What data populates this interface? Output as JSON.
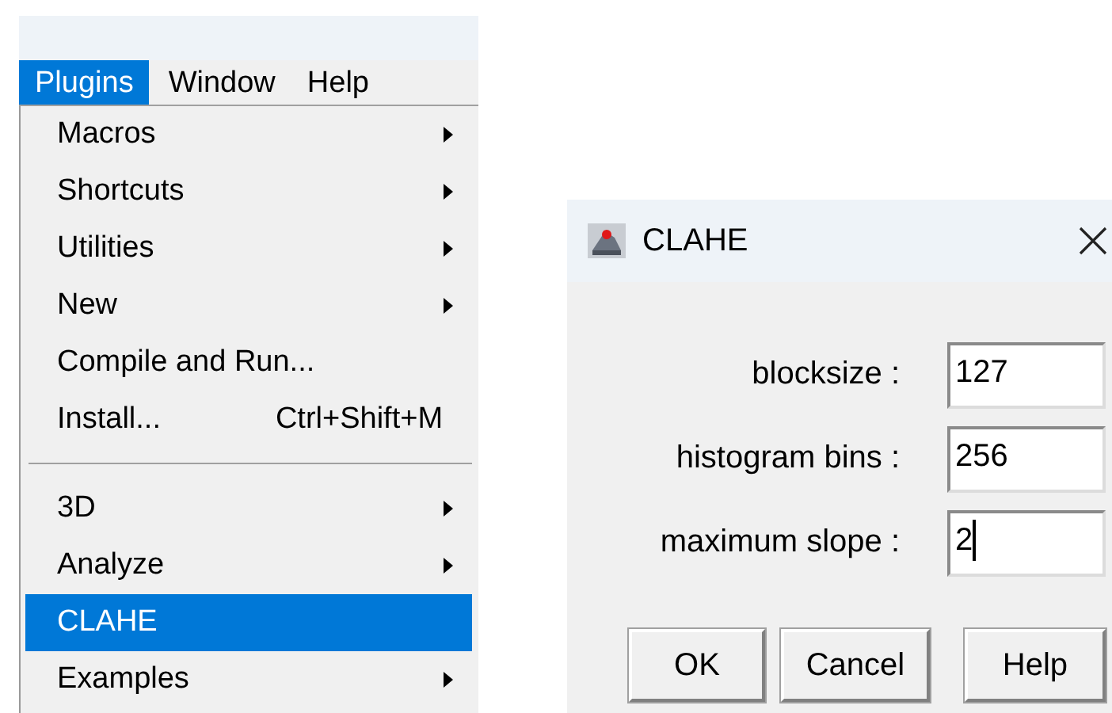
{
  "menubar": [
    {
      "label": "Plugins",
      "selected": true
    },
    {
      "label": "Window",
      "selected": false
    },
    {
      "label": "Help",
      "selected": false
    }
  ],
  "menu": [
    {
      "kind": "submenu",
      "label": "Macros",
      "selected": false
    },
    {
      "kind": "submenu",
      "label": "Shortcuts",
      "selected": false
    },
    {
      "kind": "submenu",
      "label": "Utilities",
      "selected": false
    },
    {
      "kind": "submenu",
      "label": "New",
      "selected": false
    },
    {
      "kind": "command",
      "label": "Compile and Run...",
      "selected": false
    },
    {
      "kind": "command",
      "label": "Install...",
      "shortcut": "Ctrl+Shift+M",
      "selected": false
    },
    {
      "kind": "separator"
    },
    {
      "kind": "submenu",
      "label": "3D",
      "selected": false
    },
    {
      "kind": "submenu",
      "label": "Analyze",
      "selected": false
    },
    {
      "kind": "command",
      "label": "CLAHE",
      "selected": true
    },
    {
      "kind": "submenu",
      "label": "Examples",
      "selected": false
    }
  ],
  "dialog": {
    "title": "CLAHE",
    "fields": [
      {
        "label": "blocksize :",
        "value": "127",
        "focused": false
      },
      {
        "label": "histogram bins :",
        "value": "256",
        "focused": false
      },
      {
        "label": "maximum slope :",
        "value": "2",
        "focused": true
      }
    ],
    "buttons": [
      "OK",
      "Cancel",
      "Help"
    ]
  }
}
